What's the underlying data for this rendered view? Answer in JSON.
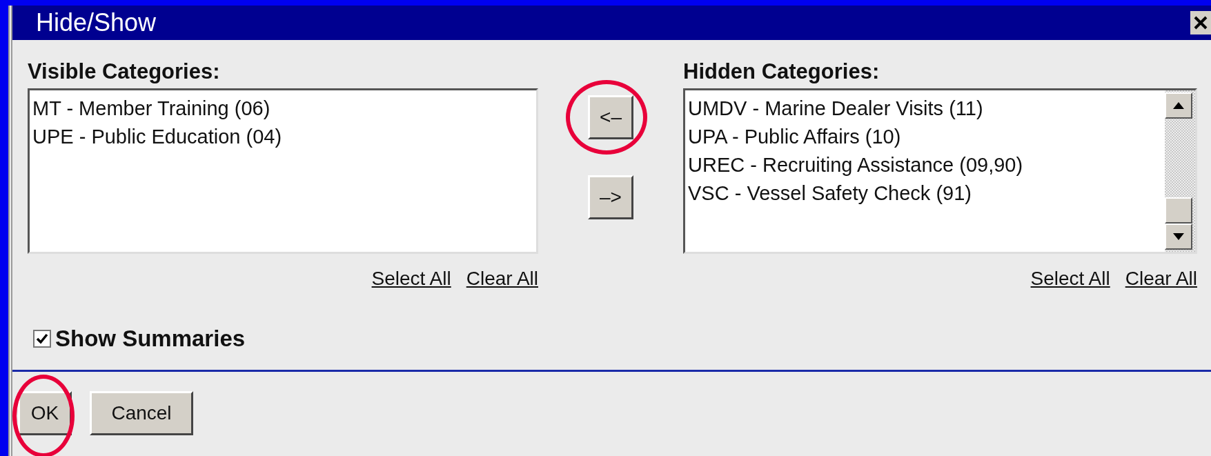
{
  "window": {
    "title": "Hide/Show"
  },
  "visible": {
    "label": "Visible Categories:",
    "items": [
      "MT - Member Training (06)",
      "UPE - Public Education (04)"
    ],
    "links": [
      "Select All",
      "Clear All"
    ]
  },
  "move_buttons": [
    {
      "label": "<–",
      "highlighted": true
    },
    {
      "label": "–>",
      "highlighted": false
    }
  ],
  "hidden": {
    "label": "Hidden Categories:",
    "items": [
      "UMDV - Marine Dealer Visits (11)",
      "UPA - Public Affairs (10)",
      "UREC - Recruiting Assistance (09,90)",
      "VSC - Vessel Safety Check (91)"
    ],
    "links": [
      "Select All",
      "Clear All"
    ]
  },
  "show_summaries": {
    "label": "Show Summaries",
    "checked": true
  },
  "buttons": [
    {
      "label": "OK",
      "highlighted": true
    },
    {
      "label": "Cancel",
      "highlighted": false
    }
  ]
}
